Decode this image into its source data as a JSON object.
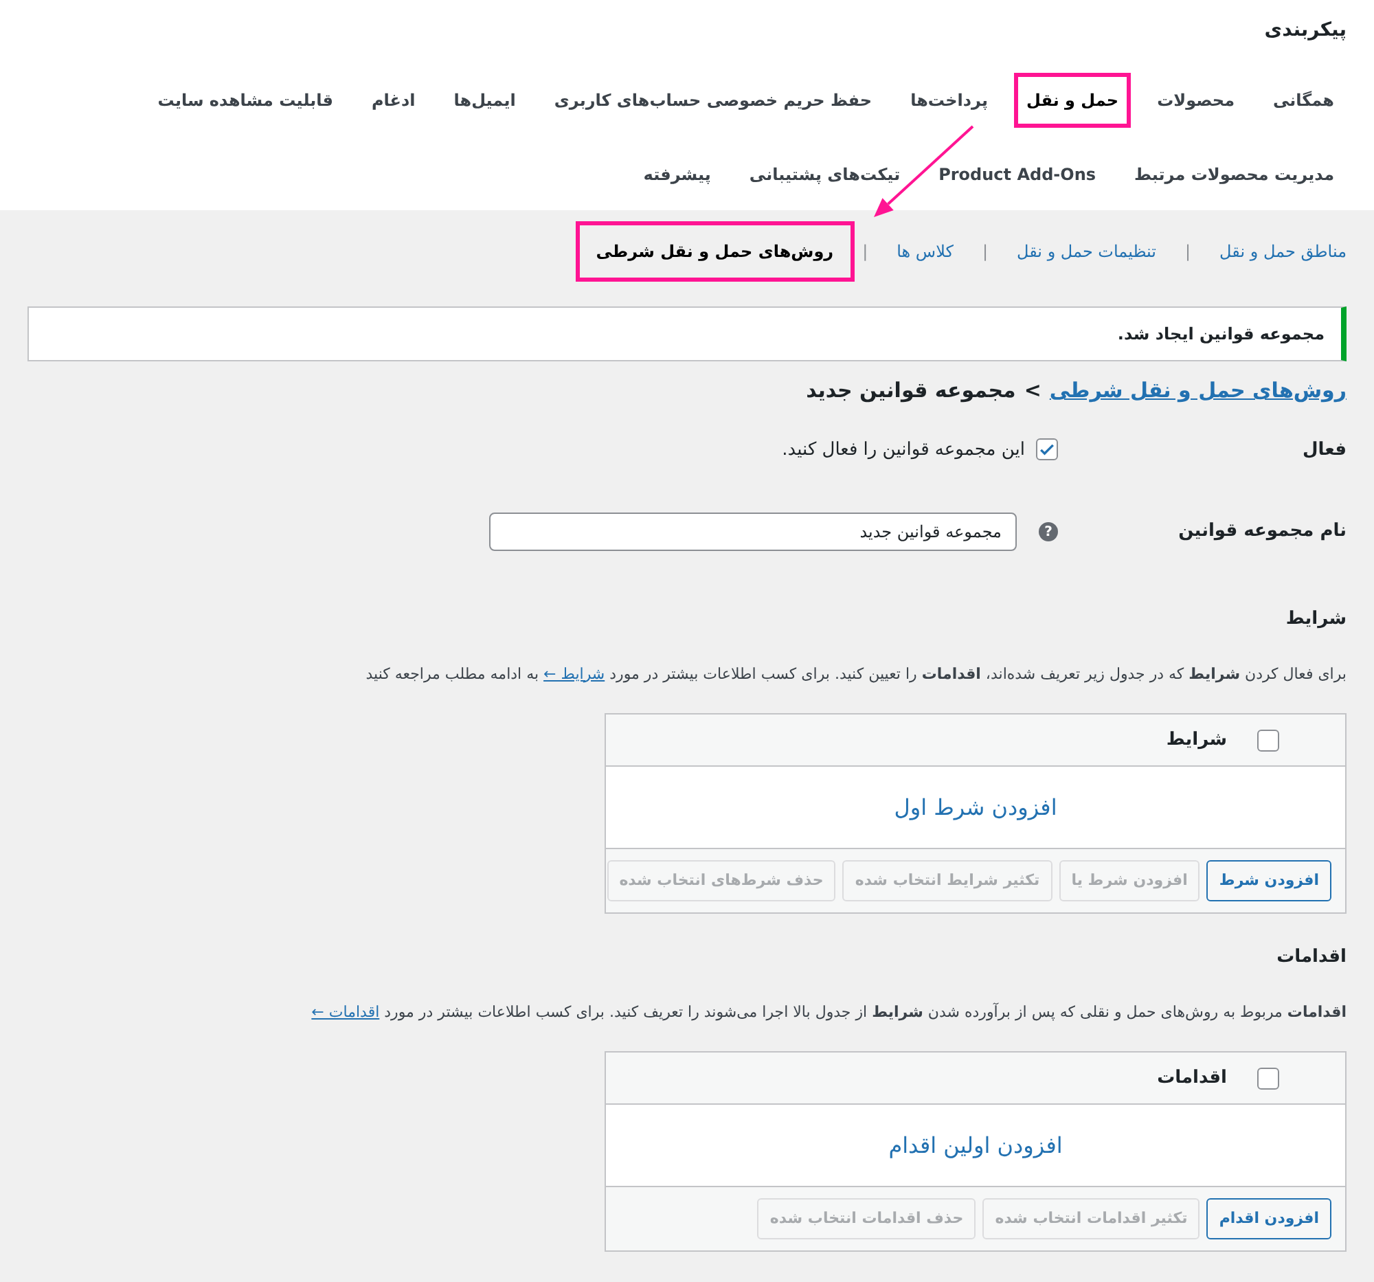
{
  "page_title": "پیکربندی",
  "tabs": [
    {
      "label": "همگانی",
      "selected": false,
      "highlighted": false
    },
    {
      "label": "محصولات",
      "selected": false,
      "highlighted": false
    },
    {
      "label": "حمل و نقل",
      "selected": true,
      "highlighted": true
    },
    {
      "label": "پرداخت‌ها",
      "selected": false,
      "highlighted": false
    },
    {
      "label": "حفظ حریم خصوصی حساب‌های کاربری",
      "selected": false,
      "highlighted": false
    },
    {
      "label": "ایمیل‌ها",
      "selected": false,
      "highlighted": false
    },
    {
      "label": "ادغام",
      "selected": false,
      "highlighted": false
    },
    {
      "label": "قابلیت مشاهده سایت",
      "selected": false,
      "highlighted": false
    },
    {
      "label": "مدیریت محصولات مرتبط",
      "selected": false,
      "highlighted": false
    },
    {
      "label": "Product Add-Ons",
      "selected": false,
      "highlighted": false
    },
    {
      "label": "تیکت‌های پشتیبانی",
      "selected": false,
      "highlighted": false
    },
    {
      "label": "پیشرفته",
      "selected": false,
      "highlighted": false
    }
  ],
  "subnav": [
    {
      "label": "مناطق حمل و نقل",
      "selected": false,
      "highlighted": false
    },
    {
      "label": "تنظیمات حمل و نقل",
      "selected": false,
      "highlighted": false
    },
    {
      "label": "کلاس ها",
      "selected": false,
      "highlighted": false
    },
    {
      "label": "روش‌های حمل و نقل شرطی",
      "selected": true,
      "highlighted": true
    }
  ],
  "subnav_separators": [
    "|",
    "|",
    "|"
  ],
  "notice": "مجموعه قوانین ایجاد شد.",
  "breadcrumb": {
    "link": "روش‌های حمل و نقل شرطی",
    "separator": ">",
    "current": "مجموعه قوانین جدید"
  },
  "fields": [
    {
      "kind": "checkbox",
      "label": "فعال",
      "checked": true,
      "text": "این مجموعه قوانین را فعال کنید."
    },
    {
      "kind": "text",
      "label": "نام مجموعه قوانین",
      "help": "?",
      "value": "مجموعه قوانین جدید"
    }
  ],
  "sections": [
    {
      "heading": "شرایط",
      "description": {
        "before": "برای فعال کردن **شرایط** که در جدول زیر تعریف شده‌اند، **اقدامات** را تعیین کنید. برای کسب اطلاعات بیشتر در مورد ",
        "link": "شرایط ←",
        "after": " به ادامه مطلب مراجعه کنید"
      },
      "table": {
        "header": "شرایط",
        "checked": false,
        "empty_link": "افزودن شرط اول",
        "buttons": [
          {
            "label": "افزودن شرط",
            "disabled": false
          },
          {
            "label": "افزودن شرط یا",
            "disabled": true
          },
          {
            "label": "تکثیر شرایط انتخاب شده",
            "disabled": true
          },
          {
            "label": "حذف شرط‌های انتخاب شده",
            "disabled": true
          }
        ]
      }
    },
    {
      "heading": "اقدامات",
      "description": {
        "before": "**اقدامات** مربوط به روش‌های حمل و نقلی که پس از برآورده شدن **شرایط** از جدول بالا اجرا می‌شوند را تعریف کنید. برای کسب اطلاعات بیشتر در مورد ",
        "link": "اقدامات ←"
      },
      "table": {
        "header": "اقدامات",
        "checked": false,
        "empty_link": "افزودن اولین اقدام",
        "buttons": [
          {
            "label": "افزودن اقدام",
            "disabled": false
          },
          {
            "label": "تکثیر اقدامات انتخاب شده",
            "disabled": true
          },
          {
            "label": "حذف اقدامات انتخاب شده",
            "disabled": true
          }
        ]
      }
    }
  ]
}
